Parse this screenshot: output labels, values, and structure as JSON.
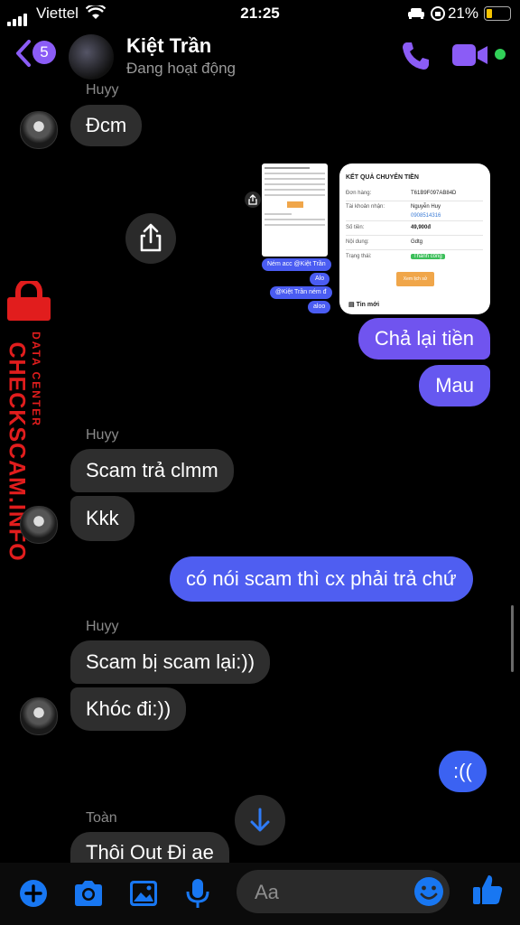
{
  "status_bar": {
    "carrier": "Viettel",
    "time": "21:25",
    "battery": "21%"
  },
  "header": {
    "back_count": "5",
    "name": "Kiệt Trần",
    "status": "Đang hoạt động"
  },
  "watermark": {
    "main": "CHECKSCAM.INFO",
    "sub": "DATA CENTER"
  },
  "messages": {
    "group1": {
      "sender": "Huyy",
      "text": "Đcm"
    },
    "attachment": {
      "mini_bubbles": [
        "Ném acc @Kiệt Trần",
        "Alo",
        "@Kiệt Trần ném đ",
        "aloo"
      ],
      "receipt": {
        "title": "KẾT QUẢ CHUYỂN TIỀN",
        "rows": [
          {
            "k": "Đơn hàng:",
            "v": "T61B9F097AB84D"
          },
          {
            "k": "Tài khoản nhận:",
            "v": "Nguyễn Huy",
            "v2": "0908514316"
          },
          {
            "k": "Số tiền:",
            "v": "49,900đ"
          },
          {
            "k": "Nội dung:",
            "v": "Gdtg"
          },
          {
            "k": "Trạng thái:",
            "v": "Thành công"
          }
        ],
        "button": "Xem lịch sử",
        "news": "Tin mới"
      }
    },
    "out1": [
      "Chả lại tiền",
      "Mau"
    ],
    "group2": {
      "sender": "Huyy",
      "texts": [
        "Scam trả clmm",
        "Kkk"
      ]
    },
    "out2": "có nói scam thì cx phải trả chứ",
    "group3": {
      "sender": "Huyy",
      "texts": [
        "Scam bị scam lại:))",
        "Khóc đi:))"
      ]
    },
    "out3": ":((",
    "group4": {
      "sender": "Toàn",
      "text": "Thôi Out Đi ae"
    }
  },
  "composer": {
    "placeholder": "Aa"
  },
  "colors": {
    "accent": "#8b5cf6",
    "outgoing_top": "#6f53f0",
    "outgoing_bottom": "#3f61f2",
    "incoming": "#2e2e2e",
    "messenger_blue": "#1877f2"
  },
  "icons": [
    "back-chevron-icon",
    "phone-icon",
    "video-camera-icon",
    "share-icon",
    "arrow-down-icon",
    "plus-icon",
    "camera-icon",
    "image-icon",
    "microphone-icon",
    "emoji-icon",
    "thumbs-up-icon",
    "lock-icon"
  ]
}
